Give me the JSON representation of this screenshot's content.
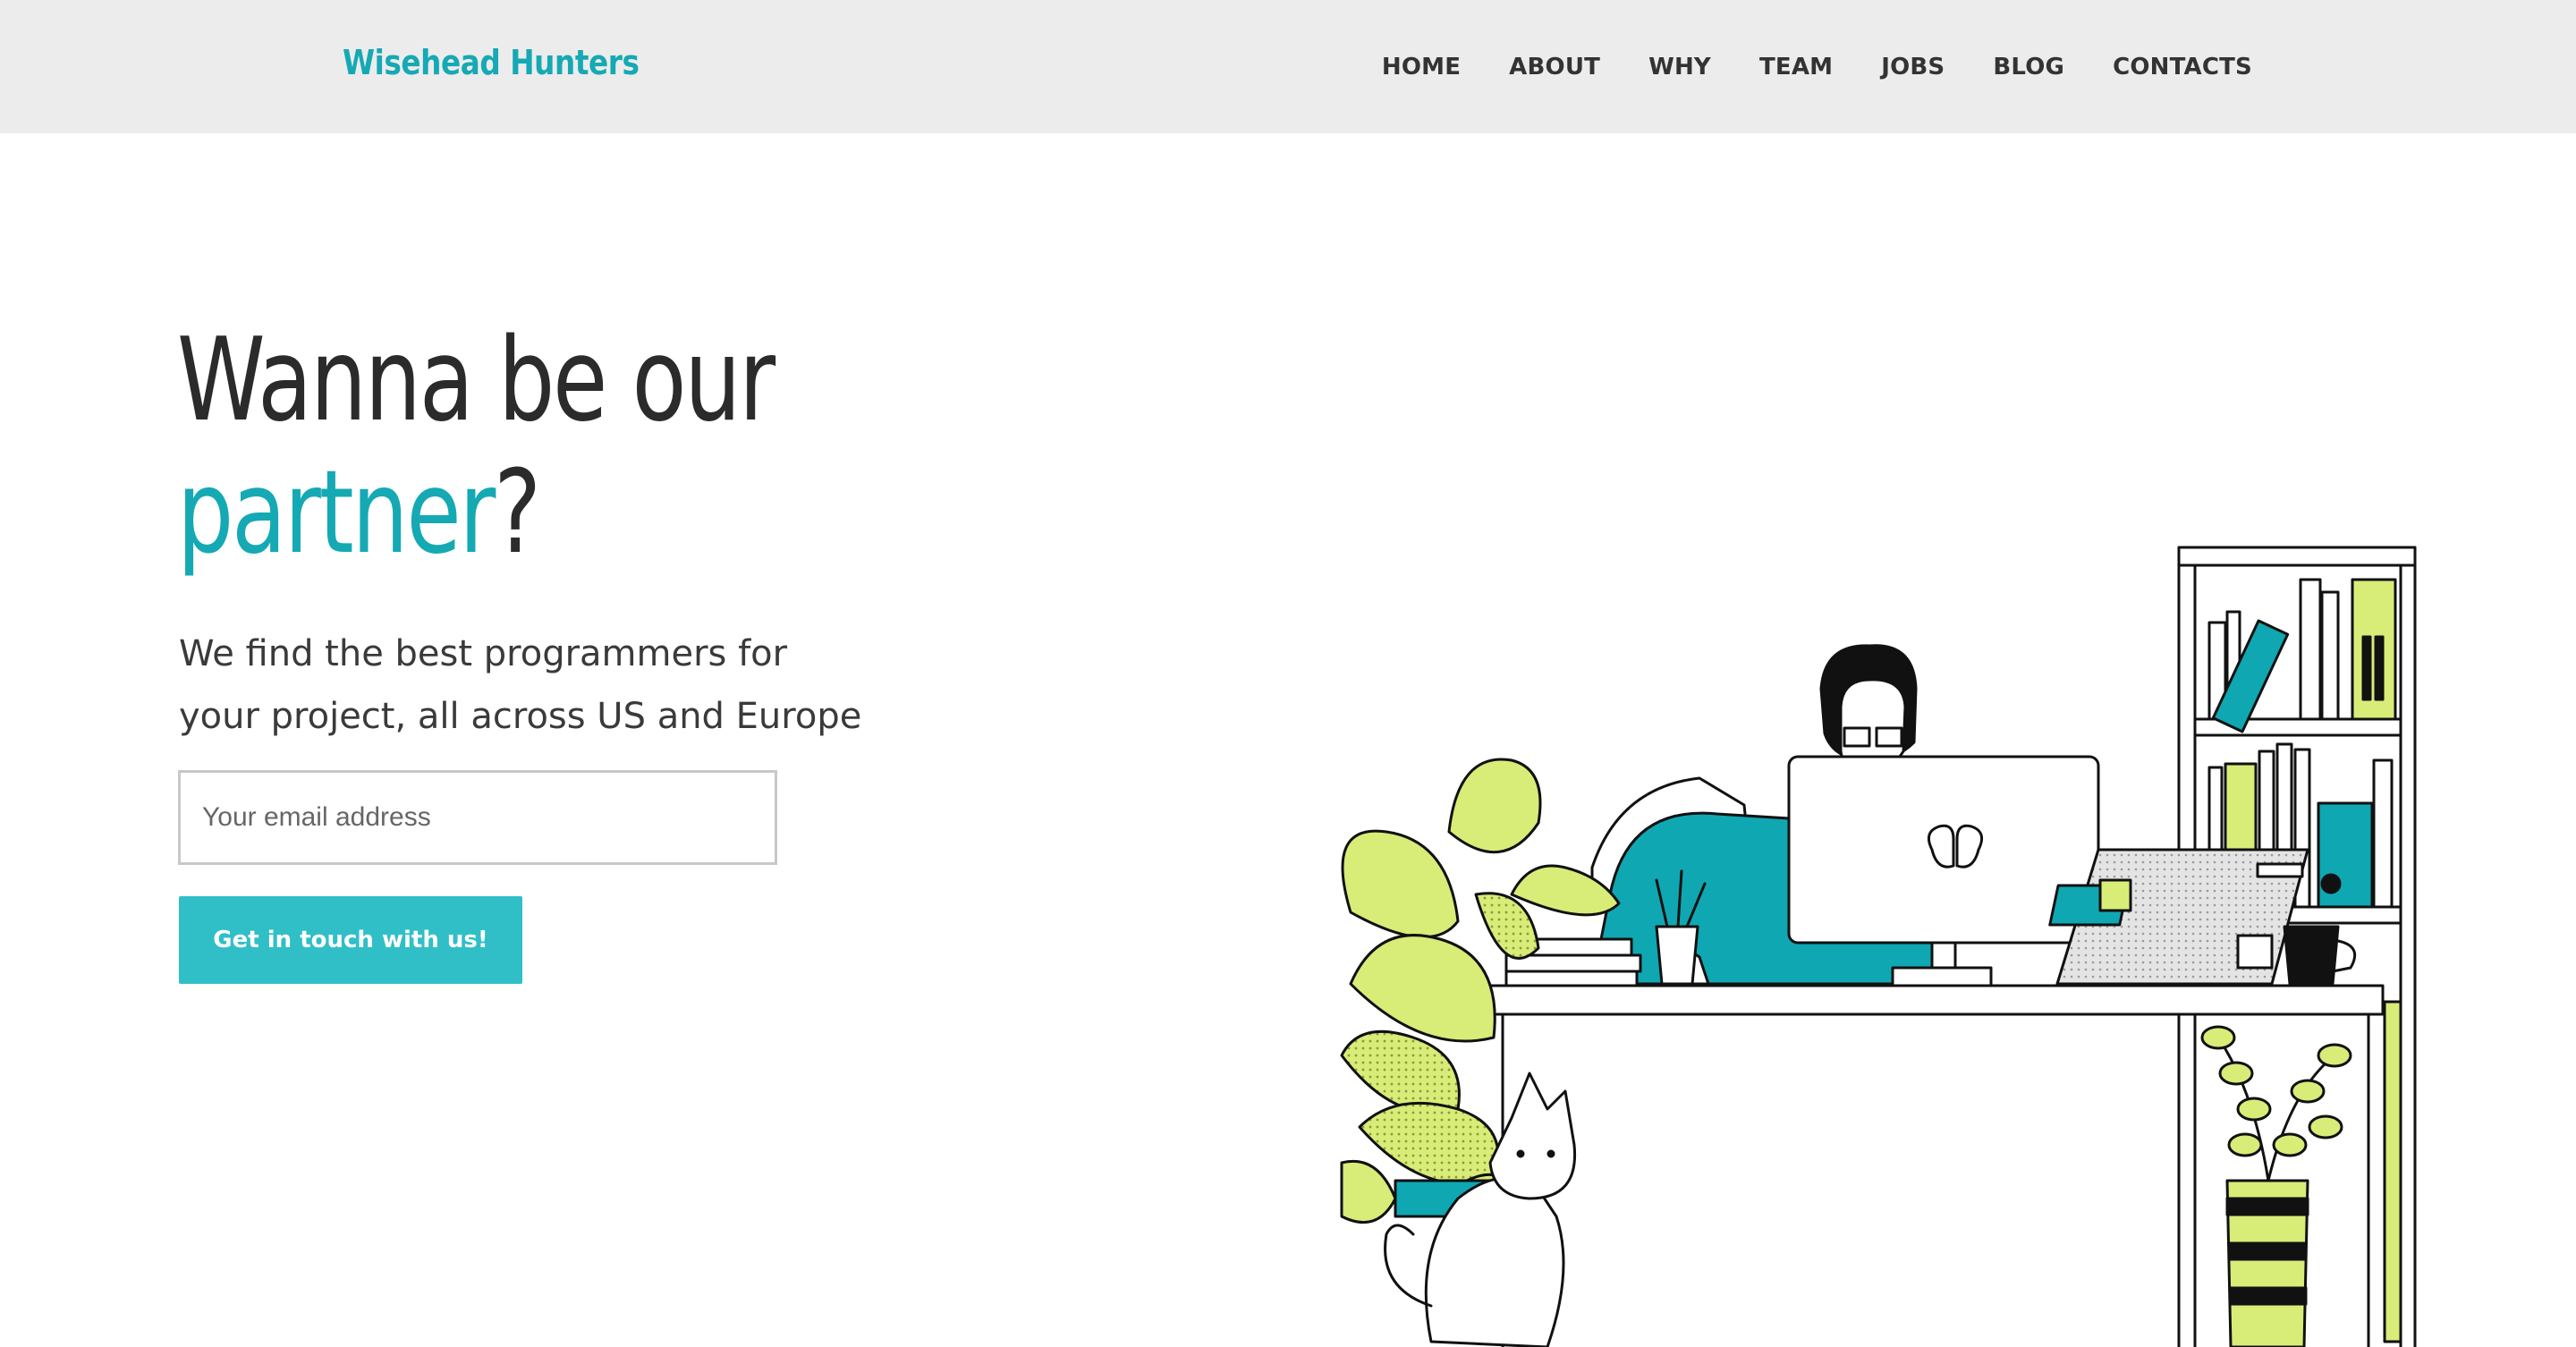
{
  "header": {
    "brand": "Wisehead Hunters",
    "nav": [
      "HOME",
      "ABOUT",
      "WHY",
      "TEAM",
      "JOBS",
      "BLOG",
      "CONTACTS"
    ]
  },
  "hero": {
    "headline_line1": "Wanna be our",
    "headline_accent": "partner",
    "headline_end": "?",
    "subtitle": "We find the best programmers for your project, all across US and Europe",
    "email_placeholder": "Your email address",
    "cta_label": "Get in touch with us!"
  },
  "colors": {
    "accent": "#15a9b4",
    "button": "#30bfc7",
    "header_bg": "#ececec",
    "illustration_green": "#d8ec78",
    "illustration_teal": "#0fa7b2"
  }
}
